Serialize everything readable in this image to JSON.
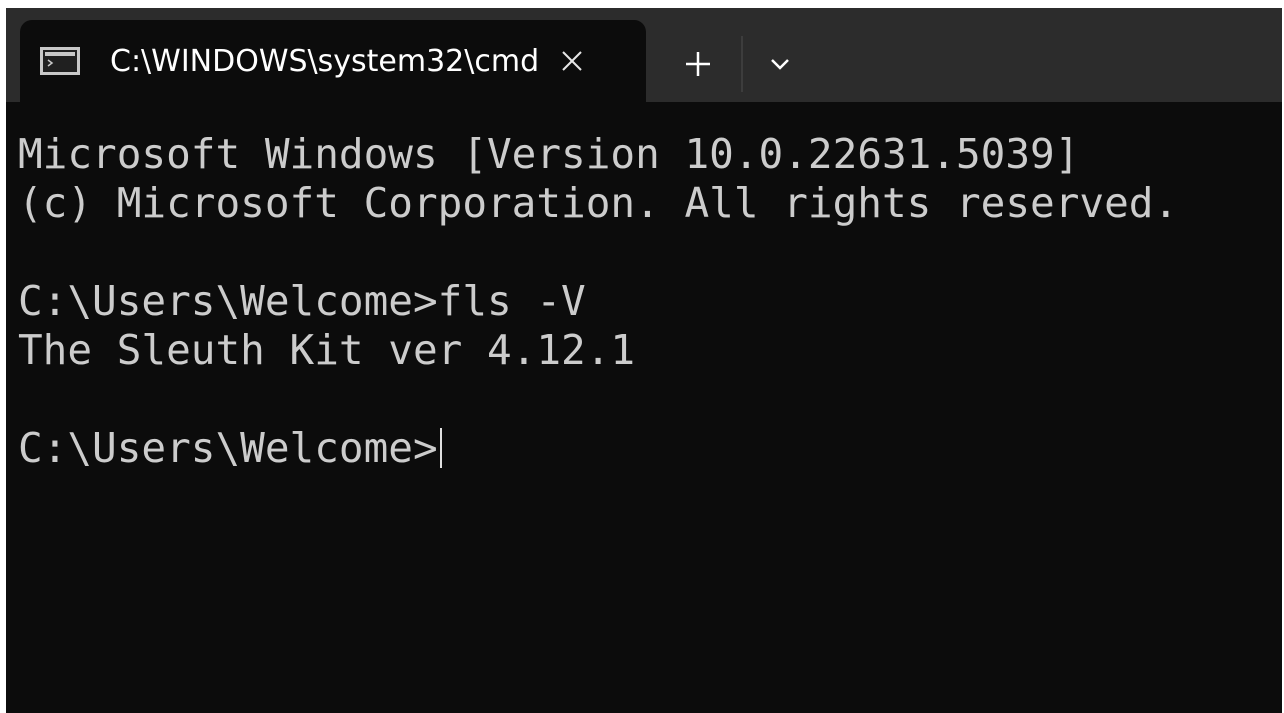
{
  "tab": {
    "title": "C:\\WINDOWS\\system32\\cmd.",
    "icon": "command-prompt-icon"
  },
  "titlebar": {
    "close_icon": "close-icon",
    "new_tab_icon": "plus-icon",
    "dropdown_icon": "chevron-down-icon"
  },
  "terminal": {
    "lines": [
      "Microsoft Windows [Version 10.0.22631.5039]",
      "(c) Microsoft Corporation. All rights reserved.",
      "",
      "C:\\Users\\Welcome>fls -V",
      "The Sleuth Kit ver 4.12.1",
      "",
      "C:\\Users\\Welcome>"
    ]
  },
  "colors": {
    "background": "#0c0c0c",
    "titlebar": "#2c2c2c",
    "text": "#cccccc"
  }
}
